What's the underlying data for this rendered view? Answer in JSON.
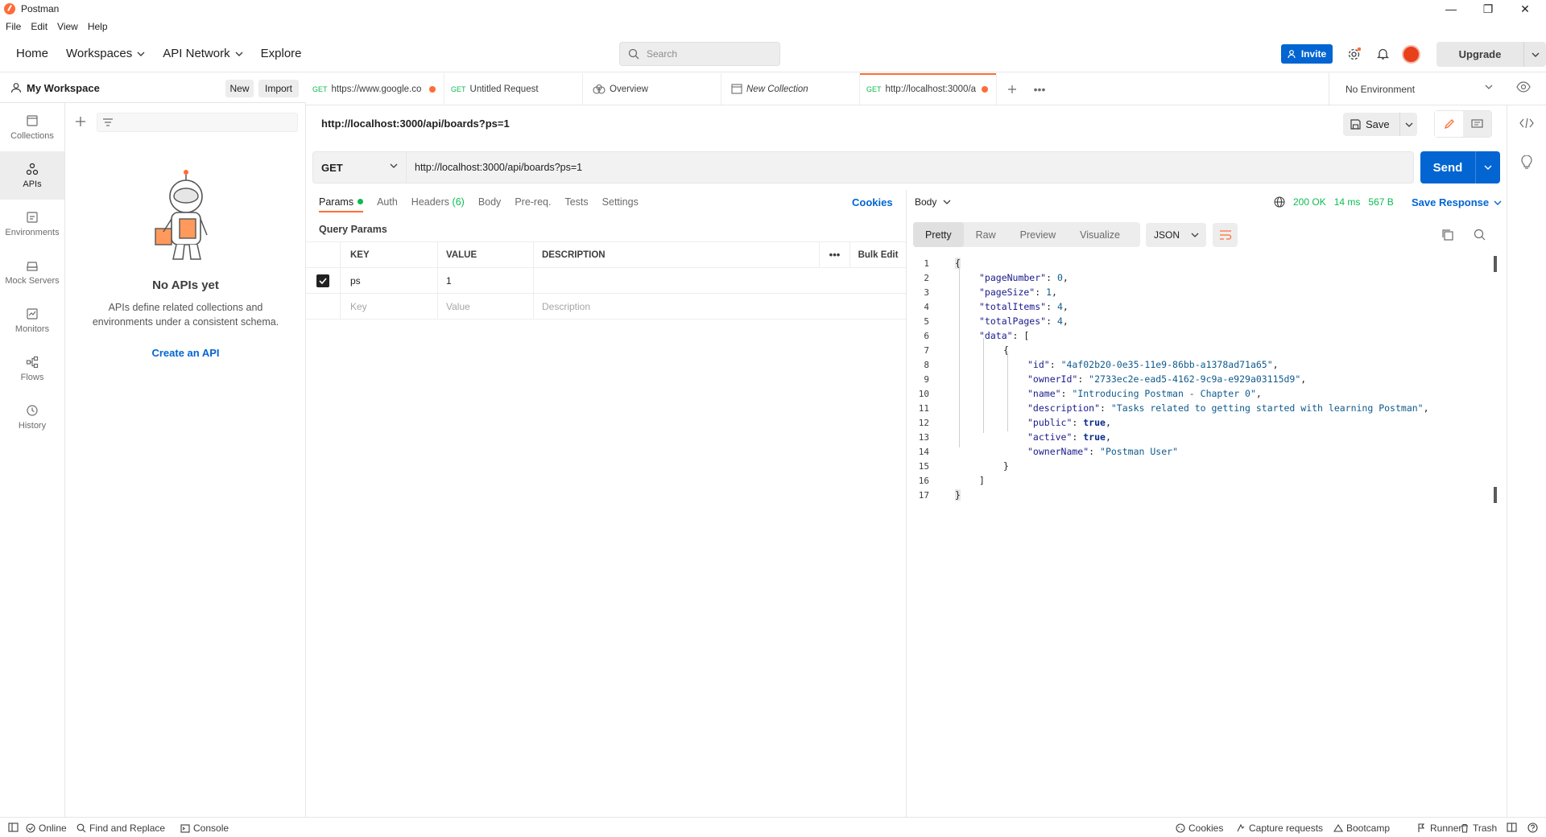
{
  "window": {
    "title": "Postman"
  },
  "menu": [
    "File",
    "Edit",
    "View",
    "Help"
  ],
  "header": {
    "nav": {
      "home": "Home",
      "workspaces": "Workspaces",
      "api_network": "API Network",
      "explore": "Explore"
    },
    "search_placeholder": "Search",
    "invite": "Invite",
    "upgrade": "Upgrade"
  },
  "workspace": {
    "name": "My Workspace",
    "new": "New",
    "import": "Import"
  },
  "rail": {
    "collections": "Collections",
    "apis": "APIs",
    "environments": "Environments",
    "mock_servers": "Mock Servers",
    "monitors": "Monitors",
    "flows": "Flows",
    "history": "History"
  },
  "empty_state": {
    "title": "No APIs yet",
    "description": "APIs define related collections and environments under a consistent schema.",
    "link": "Create an API"
  },
  "tabs": [
    {
      "method": "GET",
      "label": "https://www.google.co",
      "unsaved": true
    },
    {
      "method": "GET",
      "label": "Untitled Request"
    },
    {
      "method": "",
      "label": "Overview"
    },
    {
      "method": "",
      "label": "New Collection"
    },
    {
      "method": "GET",
      "label": "http://localhost:3000/a",
      "unsaved": true
    }
  ],
  "environment": "No Environment",
  "request": {
    "title": "http://localhost:3000/api/boards?ps=1",
    "method": "GET",
    "url": "http://localhost:3000/api/boards?ps=1",
    "save": "Save",
    "send": "Send",
    "tabs": {
      "params": "Params",
      "auth": "Auth",
      "headers": "Headers",
      "headers_count": "(6)",
      "body": "Body",
      "prereq": "Pre-req.",
      "tests": "Tests",
      "settings": "Settings"
    },
    "cookies": "Cookies",
    "query_params_title": "Query Params",
    "table": {
      "headers": {
        "key": "KEY",
        "value": "VALUE",
        "description": "DESCRIPTION",
        "bulk_edit": "Bulk Edit"
      },
      "row": {
        "key": "ps",
        "value": "1",
        "description": ""
      },
      "placeholders": {
        "key": "Key",
        "value": "Value",
        "description": "Description"
      }
    }
  },
  "response": {
    "body_label": "Body",
    "status": "200 OK",
    "time": "14 ms",
    "size": "567 B",
    "save_response": "Save Response",
    "view_tabs": {
      "pretty": "Pretty",
      "raw": "Raw",
      "preview": "Preview",
      "visualize": "Visualize"
    },
    "format": "JSON",
    "lines": [
      "1",
      "2",
      "3",
      "4",
      "5",
      "6",
      "7",
      "8",
      "9",
      "10",
      "11",
      "12",
      "13",
      "14",
      "15",
      "16",
      "17"
    ],
    "json": {
      "pageNumber": "0",
      "pageSize": "1",
      "totalItems": "4",
      "totalPages": "4",
      "id": "\"4af02b20-0e35-11e9-86bb-a1378ad71a65\"",
      "ownerId": "\"2733ec2e-ead5-4162-9c9a-e929a03115d9\"",
      "name": "\"Introducing Postman - Chapter 0\"",
      "description": "\"Tasks related to getting started with learning Postman\"",
      "public": "true",
      "active": "true",
      "ownerName": "\"Postman User\""
    }
  },
  "statusbar": {
    "online": "Online",
    "find_replace": "Find and Replace",
    "console": "Console",
    "cookies": "Cookies",
    "capture": "Capture requests",
    "bootcamp": "Bootcamp",
    "runner": "Runner",
    "trash": "Trash"
  }
}
